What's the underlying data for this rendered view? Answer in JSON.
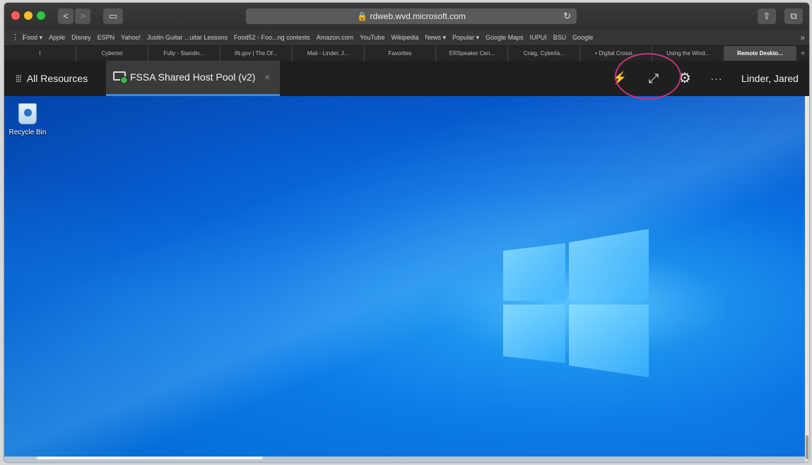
{
  "browser": {
    "url": "rdweb.wvd.microsoft.com",
    "lock_icon": "lock-icon",
    "reload_glyph": "↻",
    "back_glyph": "<",
    "forward_glyph": ">",
    "sidebar_glyph": "▭",
    "share_glyph": "⇪",
    "tabs_glyph": "⧉",
    "bookmarks": [
      "Food ▾",
      "Apple",
      "Disney",
      "ESPN",
      "Yahoo!",
      "Justin Guitar ...uitar Lessons",
      "Food52 - Foo...ng contests",
      "Amazon.com",
      "YouTube",
      "Wikipedia",
      "News ▾",
      "Popular ▾",
      "Google Maps",
      "IUPUI",
      "BSU",
      "Google"
    ],
    "bookmarks_more": "»",
    "tabs": [
      {
        "label": "I",
        "active": false
      },
      {
        "label": "Cybertel",
        "active": false
      },
      {
        "label": "Fully - Standin...",
        "active": false
      },
      {
        "label": "IN.gov | The Of...",
        "active": false
      },
      {
        "label": "Mail - Linder, J...",
        "active": false
      },
      {
        "label": "Favorites",
        "active": false
      },
      {
        "label": "ERSpeaker Cen...",
        "active": false
      },
      {
        "label": "Craig, Cyberla...",
        "active": false
      },
      {
        "label": "• Digital Crossi...",
        "active": false
      },
      {
        "label": "Using the Wind...",
        "active": false
      },
      {
        "label": "Remote Deskto...",
        "active": true
      }
    ],
    "new_tab_glyph": "+"
  },
  "rd_client": {
    "all_resources_label": "All Resources",
    "all_resources_icon": "grid-icon",
    "session_title": "FSSA Shared Host Pool (v2)",
    "session_close": "×",
    "disconnect_glyph": "⚡",
    "fullscreen_glyph": "⤢",
    "settings_glyph": "⚙",
    "more_glyph": "···",
    "user_name": "Linder, Jared"
  },
  "desktop": {
    "recycle_bin_label": "Recycle Bin"
  },
  "colors": {
    "accent": "#2f8fe0",
    "highlight_circle": "#c4357a"
  }
}
